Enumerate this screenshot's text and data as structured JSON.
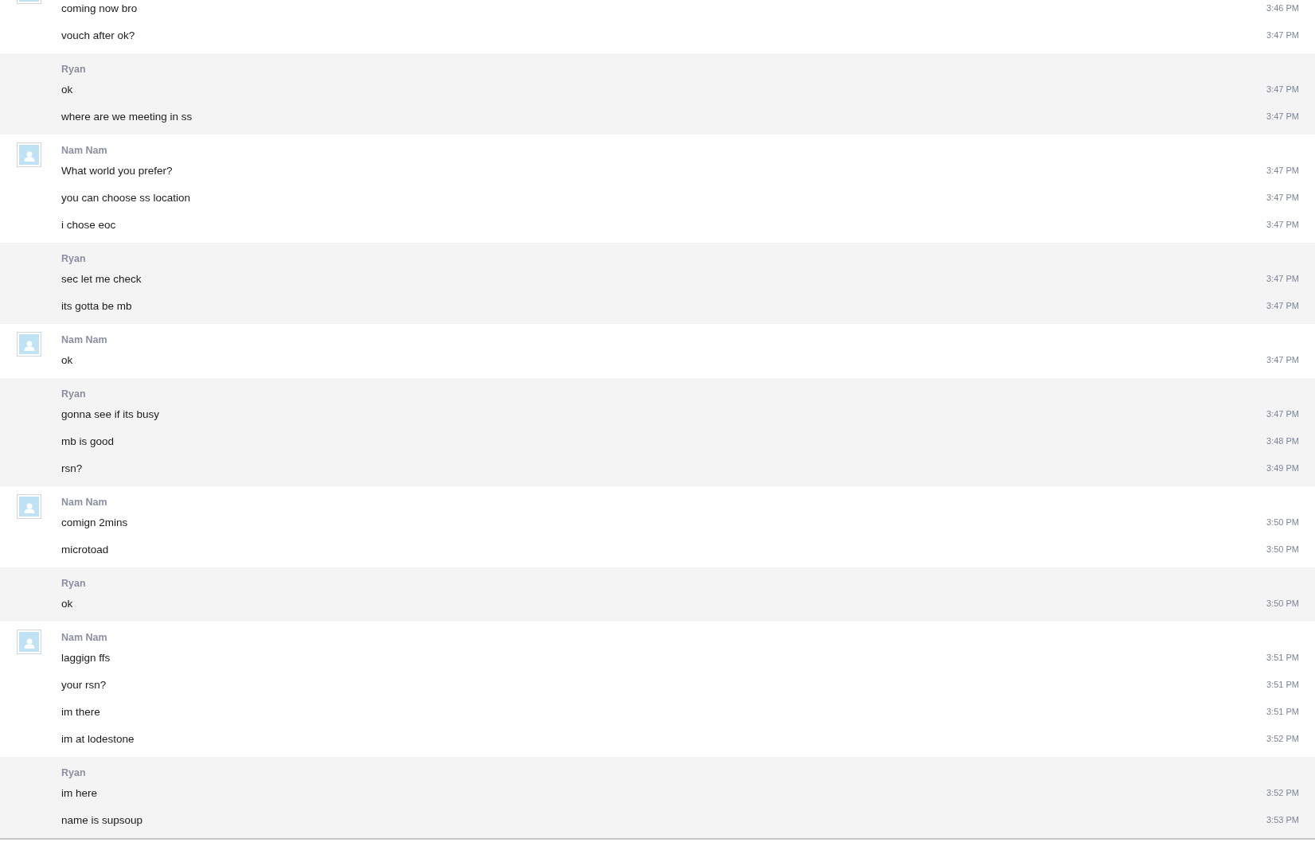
{
  "groups": [
    {
      "kind": "remote",
      "messages": [
        {
          "text": "coming now bro",
          "time": "3:46 PM"
        },
        {
          "text": "vouch after ok?",
          "time": "3:47 PM"
        }
      ]
    },
    {
      "kind": "local",
      "sender": "Ryan",
      "messages": [
        {
          "text": "ok",
          "time": "3:47 PM"
        },
        {
          "text": "where are we meeting in ss",
          "time": "3:47 PM"
        }
      ]
    },
    {
      "kind": "remote",
      "sender": "Nam Nam",
      "messages": [
        {
          "text": "What world you prefer?",
          "time": "3:47 PM"
        },
        {
          "text": "you can choose ss location",
          "time": "3:47 PM"
        },
        {
          "text": "i chose eoc",
          "time": "3:47 PM"
        }
      ]
    },
    {
      "kind": "local",
      "sender": "Ryan",
      "messages": [
        {
          "text": "sec let me check",
          "time": "3:47 PM"
        },
        {
          "text": "its gotta be mb",
          "time": "3:47 PM"
        }
      ]
    },
    {
      "kind": "remote",
      "sender": "Nam Nam",
      "messages": [
        {
          "text": "ok",
          "time": "3:47 PM"
        }
      ]
    },
    {
      "kind": "local",
      "sender": "Ryan",
      "messages": [
        {
          "text": "gonna see if its busy",
          "time": "3:47 PM"
        },
        {
          "text": "mb is good",
          "time": "3:48 PM"
        },
        {
          "text": "rsn?",
          "time": "3:49 PM"
        }
      ]
    },
    {
      "kind": "remote",
      "sender": "Nam Nam",
      "messages": [
        {
          "text": "comign 2mins",
          "time": "3:50 PM"
        },
        {
          "text": "microtoad",
          "time": "3:50 PM"
        }
      ]
    },
    {
      "kind": "local",
      "sender": "Ryan",
      "messages": [
        {
          "text": "ok",
          "time": "3:50 PM"
        }
      ]
    },
    {
      "kind": "remote",
      "sender": "Nam Nam",
      "messages": [
        {
          "text": "laggign ffs",
          "time": "3:51 PM"
        },
        {
          "text": "your rsn?",
          "time": "3:51 PM"
        },
        {
          "text": "im there",
          "time": "3:51 PM"
        },
        {
          "text": "im at lodestone",
          "time": "3:52 PM"
        }
      ]
    },
    {
      "kind": "local",
      "sender": "Ryan",
      "messages": [
        {
          "text": "im here",
          "time": "3:52 PM"
        },
        {
          "text": "name is supsoup",
          "time": "3:53 PM"
        }
      ]
    }
  ]
}
